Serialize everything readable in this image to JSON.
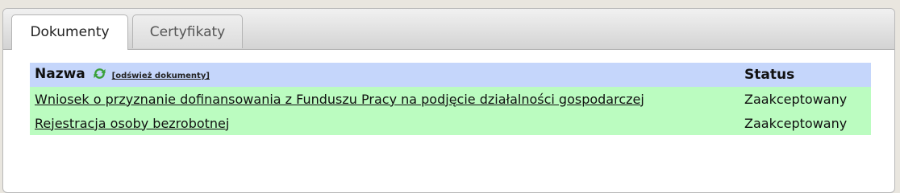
{
  "tabs": {
    "documents": "Dokumenty",
    "certificates": "Certyfikaty"
  },
  "table": {
    "header_name": "Nazwa",
    "refresh_link": "[odśwież dokumenty]",
    "header_status": "Status",
    "rows": [
      {
        "name": "Wniosek o przyznanie dofinansowania z Funduszu Pracy na podjęcie działalności gospodarczej",
        "status": "Zaakceptowany"
      },
      {
        "name": "Rejestracja osoby bezrobotnej",
        "status": "Zaakceptowany"
      }
    ]
  },
  "icons": {
    "refresh": "refresh-icon"
  },
  "colors": {
    "header_row": "#c5d6fb",
    "accepted_row": "#bbfcc0",
    "refresh_icon": "#3aa13a"
  }
}
